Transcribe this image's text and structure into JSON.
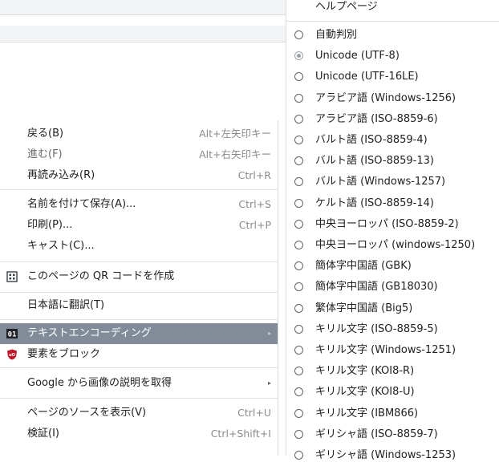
{
  "context_menu": {
    "items": [
      {
        "label": "戻る(B)",
        "accel": "Alt+左矢印キー"
      },
      {
        "label": "進む(F)",
        "accel": "Alt+右矢印キー"
      },
      {
        "label": "再読み込み(R)",
        "accel": "Ctrl+R"
      },
      {
        "label": "名前を付けて保存(A)...",
        "accel": "Ctrl+S"
      },
      {
        "label": "印刷(P)...",
        "accel": "Ctrl+P"
      },
      {
        "label": "キャスト(C)...",
        "accel": ""
      },
      {
        "label": "このページの QR コードを作成",
        "accel": ""
      },
      {
        "label": "日本語に翻訳(T)",
        "accel": ""
      },
      {
        "label": "テキストエンコーディング",
        "accel": ""
      },
      {
        "label": "要素をブロック",
        "accel": ""
      },
      {
        "label": "Google から画像の説明を取得",
        "accel": ""
      },
      {
        "label": "ページのソースを表示(V)",
        "accel": "Ctrl+U"
      },
      {
        "label": "検証(I)",
        "accel": "Ctrl+Shift+I"
      }
    ],
    "icons": {
      "qr": "qr-code-icon",
      "encoding_badge": "01",
      "ublock": "ublock-icon"
    },
    "highlight_color": "#828c99"
  },
  "encoding_submenu": {
    "header": "ヘルプページ",
    "items": [
      {
        "label": "自動判別",
        "checked": false
      },
      {
        "label": "Unicode (UTF-8)",
        "checked": true
      },
      {
        "label": "Unicode (UTF-16LE)",
        "checked": false
      },
      {
        "label": "アラビア語 (Windows-1256)",
        "checked": false
      },
      {
        "label": "アラビア語 (ISO-8859-6)",
        "checked": false
      },
      {
        "label": "バルト語 (ISO-8859-4)",
        "checked": false
      },
      {
        "label": "バルト語 (ISO-8859-13)",
        "checked": false
      },
      {
        "label": "バルト語 (Windows-1257)",
        "checked": false
      },
      {
        "label": "ケルト語 (ISO-8859-14)",
        "checked": false
      },
      {
        "label": "中央ヨーロッパ (ISO-8859-2)",
        "checked": false
      },
      {
        "label": "中央ヨーロッパ (windows-1250)",
        "checked": false
      },
      {
        "label": "簡体字中国語 (GBK)",
        "checked": false
      },
      {
        "label": "簡体字中国語 (GB18030)",
        "checked": false
      },
      {
        "label": "繁体字中国語 (Big5)",
        "checked": false
      },
      {
        "label": "キリル文字 (ISO-8859-5)",
        "checked": false
      },
      {
        "label": "キリル文字 (Windows-1251)",
        "checked": false
      },
      {
        "label": "キリル文字 (KOI8-R)",
        "checked": false
      },
      {
        "label": "キリル文字 (KOI8-U)",
        "checked": false
      },
      {
        "label": "キリル文字 (IBM866)",
        "checked": false
      },
      {
        "label": "ギリシャ語 (ISO-8859-7)",
        "checked": false
      },
      {
        "label": "ギリシャ語 (Windows-1253)",
        "checked": false
      }
    ]
  }
}
